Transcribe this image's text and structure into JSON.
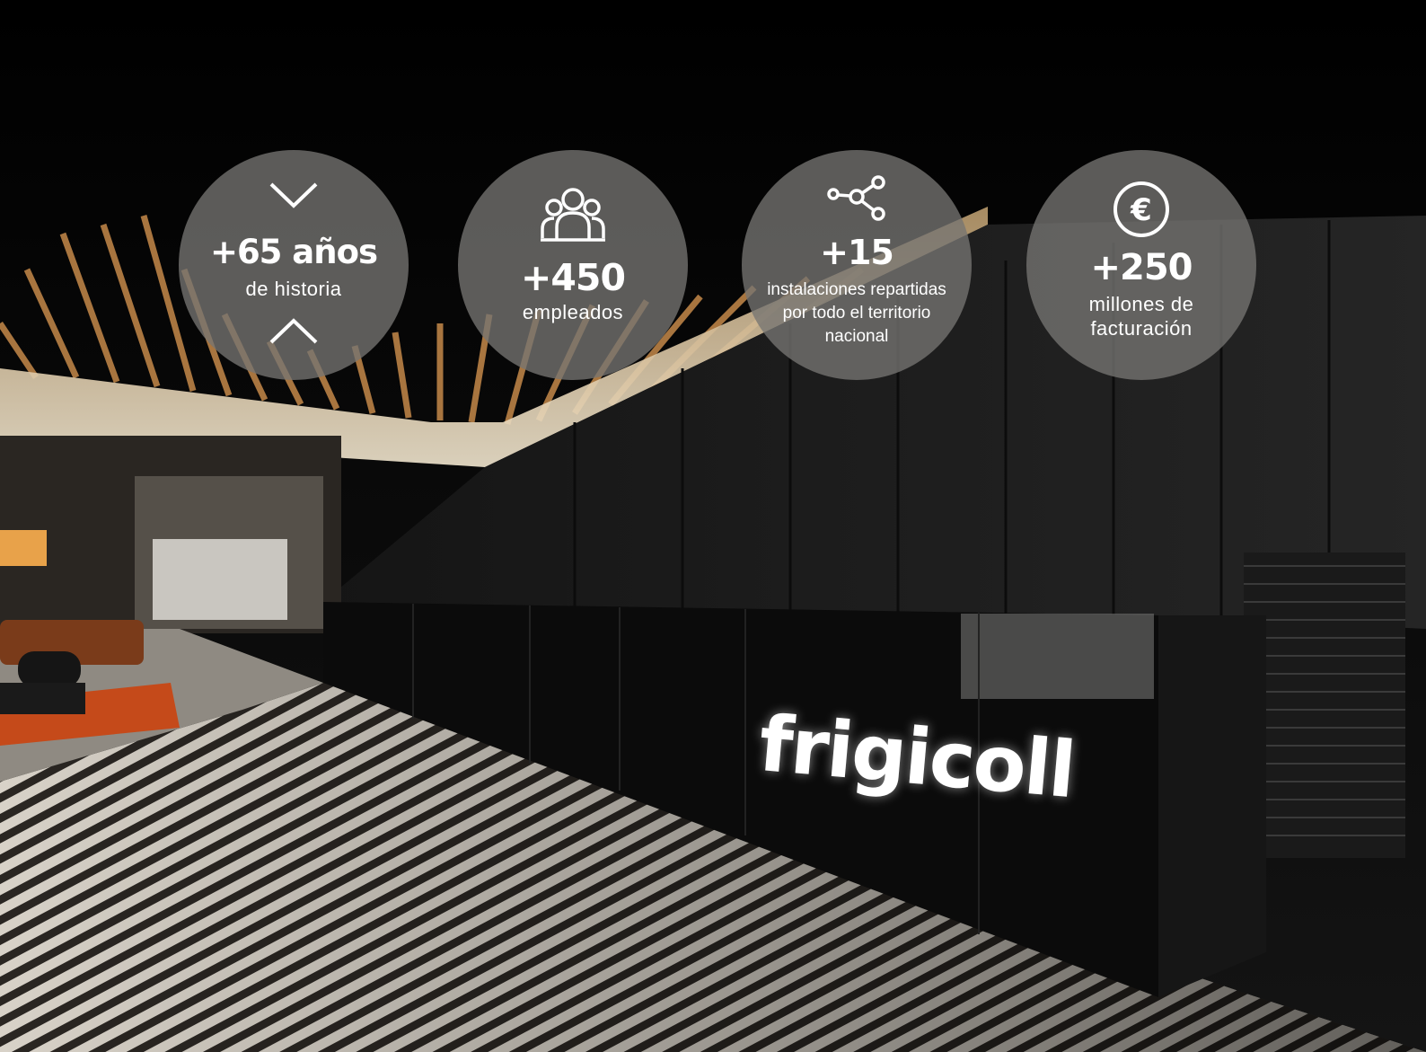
{
  "stats": [
    {
      "icon": "chevron-down-icon",
      "value": "+65 años",
      "caption": "de historia",
      "icon_bottom": "chevron-up-icon"
    },
    {
      "icon": "people-group-icon",
      "value": "+450",
      "caption": "empleados"
    },
    {
      "icon": "network-nodes-icon",
      "value": "+15",
      "caption_lines": [
        "instalaciones repartidas",
        "por todo el territorio",
        "nacional"
      ]
    },
    {
      "icon": "euro-circle-icon",
      "value": "+250",
      "caption_lines": [
        "millones de",
        "facturación"
      ]
    }
  ],
  "sign": {
    "text": "frigicoll"
  },
  "colors": {
    "circle": "#767472",
    "text": "#ffffff"
  }
}
